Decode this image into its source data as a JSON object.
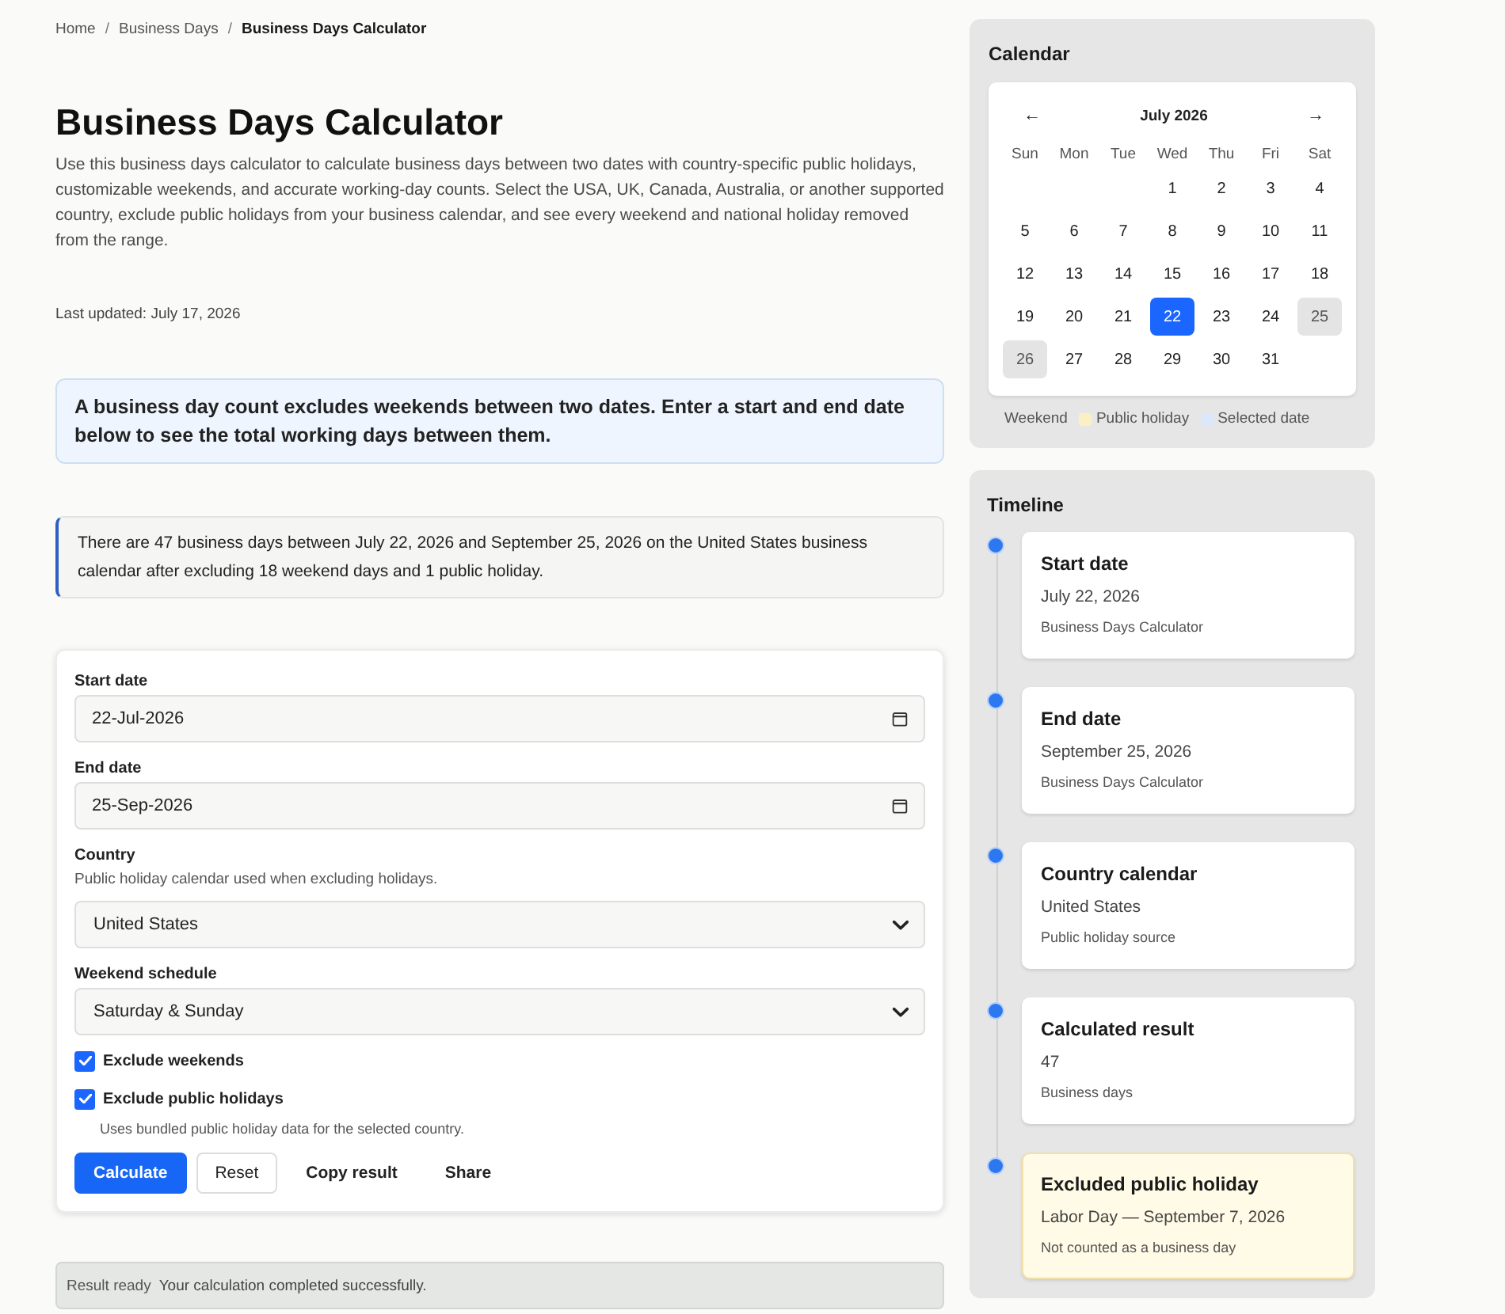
{
  "breadcrumb": {
    "separator": "/",
    "items": [
      {
        "label": "Home",
        "current": false
      },
      {
        "label": "Business Days",
        "current": false
      },
      {
        "label": "Business Days Calculator",
        "current": true
      }
    ]
  },
  "title": "Business Days Calculator",
  "description": "Use this business days calculator to calculate business days between two dates with country-specific public holidays, customizable weekends, and accurate working-day counts. Select the USA, UK, Canada, Australia, or another supported country, exclude public holidays from your business calendar, and see every weekend and national holiday removed from the range.",
  "last_updated": "Last updated: July 17, 2026",
  "callout": "A business day count excludes weekends between two dates. Enter a start and end date below to see the total working days between them.",
  "summary": "There are 47 business days between July 22, 2026 and September 25, 2026 on the United States business calendar after excluding 18 weekend days and 1 public holiday.",
  "form": {
    "fields": [
      {
        "kind": "date",
        "label": "Start date",
        "value": "22-Jul-2026"
      },
      {
        "kind": "date",
        "label": "End date",
        "value": "25-Sep-2026"
      },
      {
        "kind": "select",
        "label": "Country",
        "hint": "Public holiday calendar used when excluding holidays.",
        "value": "United States"
      },
      {
        "kind": "select",
        "label": "Weekend schedule",
        "value": "Saturday & Sunday"
      }
    ],
    "options": [
      {
        "label": "Exclude weekends",
        "checked": true
      },
      {
        "label": "Exclude public holidays",
        "checked": true,
        "hint": "Uses bundled public holiday data for the selected country."
      }
    ],
    "buttons": [
      {
        "label": "Calculate",
        "kind": "primary"
      },
      {
        "label": "Reset",
        "kind": "outline"
      },
      {
        "label": "Copy result",
        "kind": "text"
      },
      {
        "label": "Share",
        "kind": "text"
      }
    ]
  },
  "status_bar": {
    "label": "Result ready",
    "message": "Your calculation completed successfully."
  },
  "calendar": {
    "title": "Calendar",
    "prev": "←",
    "next": "→",
    "month": "July 2026",
    "weekdays": [
      "Sun",
      "Mon",
      "Tue",
      "Wed",
      "Thu",
      "Fri",
      "Sat"
    ],
    "weeks": [
      [
        {
          "label": "1",
          "selected": false,
          "weekend": false
        },
        {
          "label": "2",
          "selected": false,
          "weekend": false
        },
        {
          "label": "3",
          "selected": false,
          "weekend": false
        },
        {
          "label": "4",
          "selected": false,
          "weekend": false
        }
      ],
      [
        {
          "label": "5",
          "selected": false,
          "weekend": false
        },
        {
          "label": "6",
          "selected": false,
          "weekend": false
        },
        {
          "label": "7",
          "selected": false,
          "weekend": false
        },
        {
          "label": "8",
          "selected": false,
          "weekend": false
        },
        {
          "label": "9",
          "selected": false,
          "weekend": false
        },
        {
          "label": "10",
          "selected": false,
          "weekend": false
        },
        {
          "label": "11",
          "selected": false,
          "weekend": false
        }
      ],
      [
        {
          "label": "12",
          "selected": false,
          "weekend": false
        },
        {
          "label": "13",
          "selected": false,
          "weekend": false
        },
        {
          "label": "14",
          "selected": false,
          "weekend": false
        },
        {
          "label": "15",
          "selected": false,
          "weekend": false
        },
        {
          "label": "16",
          "selected": false,
          "weekend": false
        },
        {
          "label": "17",
          "selected": false,
          "weekend": false
        },
        {
          "label": "18",
          "selected": false,
          "weekend": false
        }
      ],
      [
        {
          "label": "19",
          "selected": false,
          "weekend": false
        },
        {
          "label": "20",
          "selected": false,
          "weekend": false
        },
        {
          "label": "21",
          "selected": false,
          "weekend": false
        },
        {
          "label": "22",
          "selected": true,
          "weekend": false
        },
        {
          "label": "23",
          "selected": false,
          "weekend": false
        },
        {
          "label": "24",
          "selected": false,
          "weekend": false
        },
        {
          "label": "25",
          "selected": false,
          "weekend": true
        }
      ],
      [
        {
          "label": "26",
          "selected": false,
          "weekend": true
        },
        {
          "label": "27",
          "selected": false,
          "weekend": false
        },
        {
          "label": "28",
          "selected": false,
          "weekend": false
        },
        {
          "label": "29",
          "selected": false,
          "weekend": false
        },
        {
          "label": "30",
          "selected": false,
          "weekend": false
        },
        {
          "label": "31",
          "selected": false,
          "weekend": false
        }
      ]
    ],
    "legend": [
      {
        "label": "Weekend"
      },
      {
        "label": "Public holiday",
        "color": "#fbf0c4"
      },
      {
        "label": "Selected date",
        "color": "#dbe7fb"
      }
    ]
  },
  "timeline": {
    "title": "Timeline",
    "items": [
      {
        "title": "Start date",
        "value": "July 22, 2026",
        "note": "Business Days Calculator",
        "highlighted": false
      },
      {
        "title": "End date",
        "value": "September 25, 2026",
        "note": "Business Days Calculator",
        "highlighted": false
      },
      {
        "title": "Country calendar",
        "value": "United States",
        "note": "Public holiday source",
        "highlighted": false
      },
      {
        "title": "Calculated result",
        "value": "47",
        "note": "Business days",
        "highlighted": false
      },
      {
        "title": "Excluded public holiday",
        "value": "Labor Day — September 7, 2026",
        "note": "Not counted as a business day",
        "highlighted": true
      }
    ]
  }
}
